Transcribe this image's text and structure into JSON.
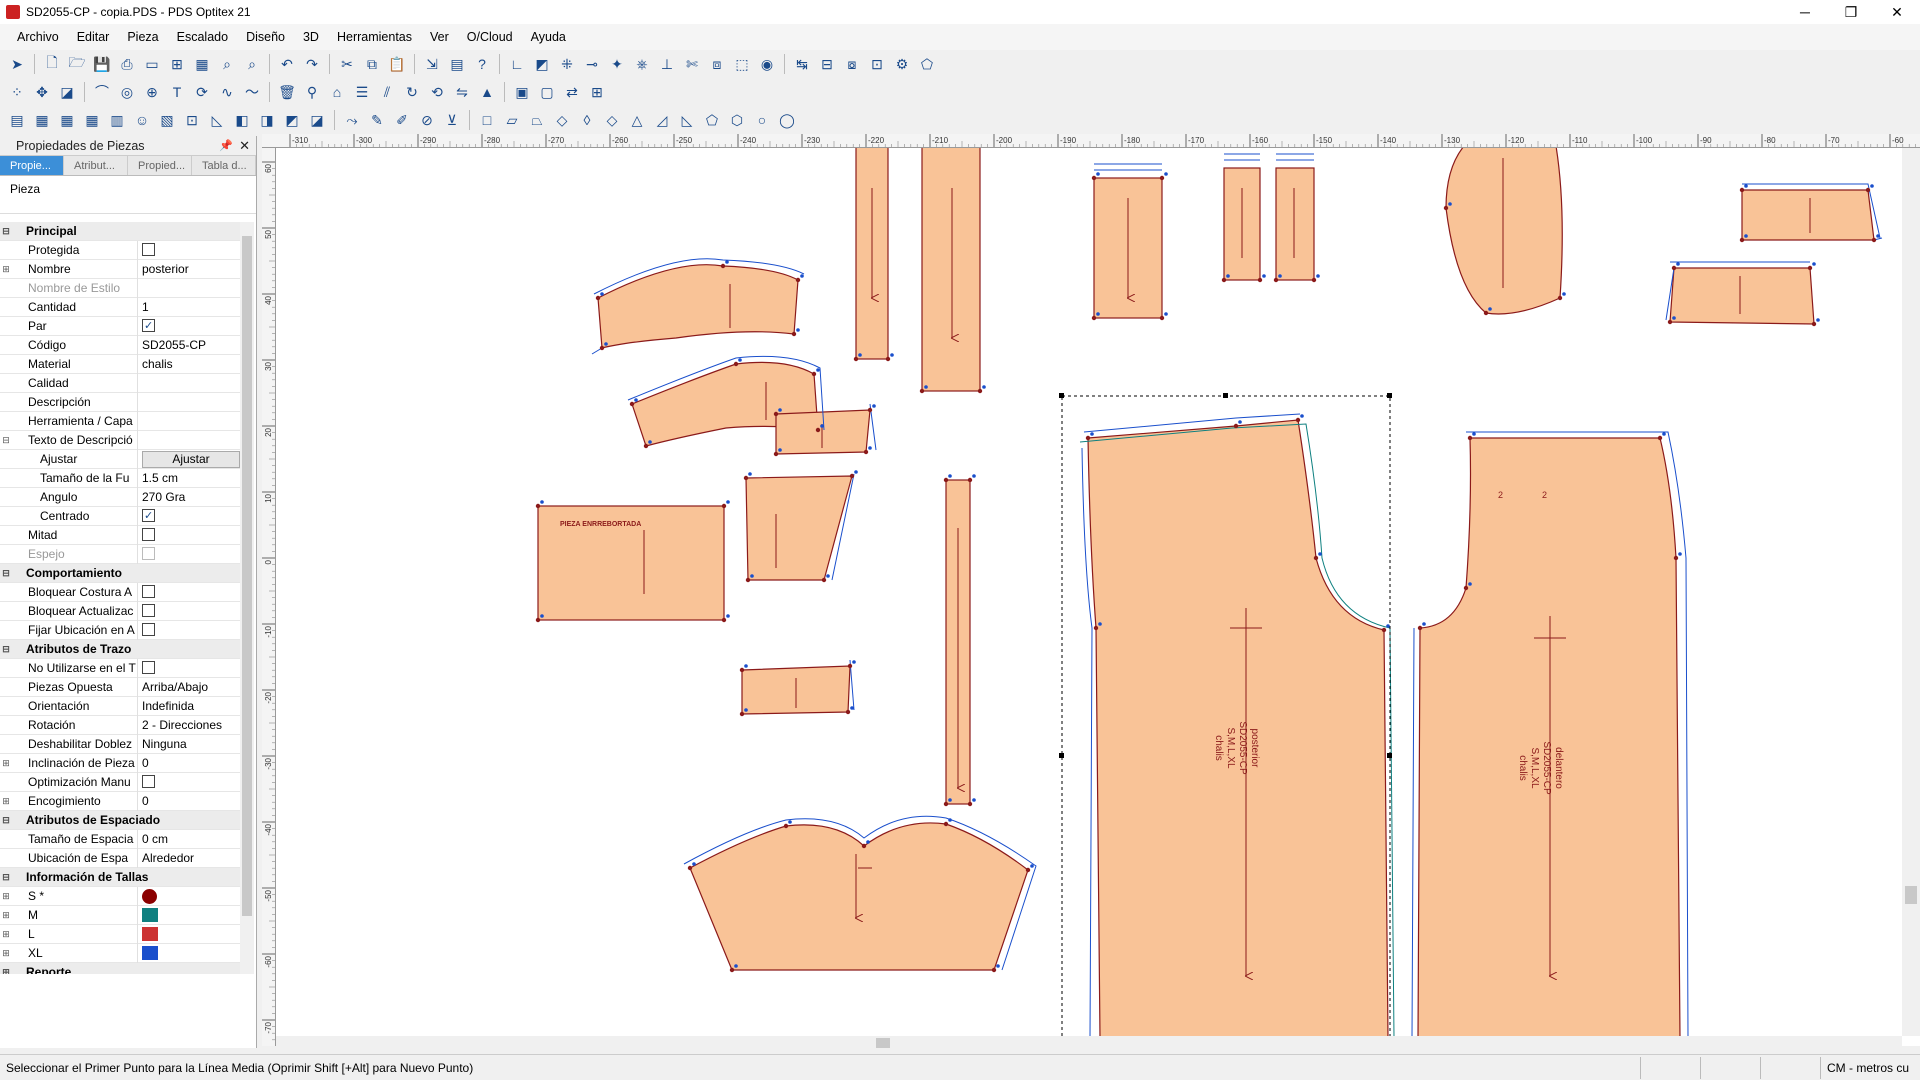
{
  "window": {
    "title": "SD2055-CP - copia.PDS - PDS Optitex 21"
  },
  "menu": [
    "Archivo",
    "Editar",
    "Pieza",
    "Escalado",
    "Diseño",
    "3D",
    "Herramientas",
    "Ver",
    "O/Cloud",
    "Ayuda"
  ],
  "panel": {
    "title": "Propiedades de Piezas",
    "tabs": [
      "Propie...",
      "Atribut...",
      "Propied...",
      "Tabla d..."
    ],
    "object_type": "Pieza"
  },
  "properties": {
    "principal": "Principal",
    "protegida": "Protegida",
    "nombre": "Nombre",
    "nombre_val": "posterior",
    "nombre_estilo": "Nombre de Estilo",
    "cantidad": "Cantidad",
    "cantidad_val": "1",
    "par": "Par",
    "codigo": "Código",
    "codigo_val": "SD2055-CP",
    "material": "Material",
    "material_val": "chalis",
    "calidad": "Calidad",
    "descripcion": "Descripción",
    "herramienta": "Herramienta / Capa",
    "texto_desc": "Texto de Descripció",
    "ajustar": "Ajustar",
    "ajustar_btn": "Ajustar",
    "tamano_fuente": "Tamaño de la Fu",
    "tamano_fuente_val": "1.5 cm",
    "angulo": "Angulo",
    "angulo_val": "270 Gra",
    "centrado": "Centrado",
    "mitad": "Mitad",
    "espejo": "Espejo",
    "comportamiento": "Comportamiento",
    "bloquear_costura": "Bloquear Costura A",
    "bloquear_actualiz": "Bloquear Actualizac",
    "fijar_ubicacion": "Fijar Ubicación en A",
    "atributos_trazo": "Atributos de Trazo",
    "no_utilizarse": "No Utilizarse en el T",
    "piezas_opuesta": "Piezas Opuesta",
    "piezas_opuesta_val": "Arriba/Abajo",
    "orientacion": "Orientación",
    "orientacion_val": "Indefinida",
    "rotacion": "Rotación",
    "rotacion_val": "2 - Direcciones",
    "deshabilitar": "Deshabilitar Doblez",
    "deshabilitar_val": "Ninguna",
    "inclinacion": "Inclinación de Pieza",
    "inclinacion_val": "0",
    "optimizacion": "Optimización Manu",
    "encogimiento": "Encogimiento",
    "encogimiento_val": "0",
    "atributos_espaciado": "Atributos de Espaciado",
    "tamano_espaciado": "Tamaño de Espacia",
    "tamano_espaciado_val": "0 cm",
    "ubicacion_espaciado": "Ubicación de Espa",
    "ubicacion_espaciado_val": "Alrededor",
    "info_tallas": "Información de Tallas",
    "talla_s": "S *",
    "talla_m": "M",
    "talla_l": "L",
    "talla_xl": "XL",
    "reporte": "Reporte"
  },
  "size_colors": {
    "S": "#8b0000",
    "M": "#0f8080",
    "L": "#cc3333",
    "XL": "#1a4fcc"
  },
  "ruler": {
    "top_labels": [
      "-310",
      "-300",
      "-290",
      "-280",
      "-270",
      "-260",
      "-250",
      "-240",
      "-230",
      "-220",
      "-210",
      "-200",
      "-190",
      "-180",
      "-170",
      "-160",
      "-150",
      "-140",
      "-130",
      "-120",
      "-110",
      "-100",
      "-90",
      "-80",
      "-70",
      "-60"
    ],
    "left_labels": [
      "60",
      "50",
      "40",
      "30",
      "20",
      "10",
      "0",
      "-10",
      "-20",
      "-30",
      "-40",
      "-50",
      "-60",
      "-70"
    ]
  },
  "pieces": {
    "label_pieza_enrre": "PIEZA ENRREBORTADA",
    "posterior_lines": [
      "posterior",
      "SD2055-CP",
      "S,M,L,XL",
      "chalis"
    ],
    "delantero_lines": [
      "delantero",
      "SD2055-CP",
      "S,M,L,XL",
      "chalis"
    ],
    "notch_label": "2"
  },
  "piece_fill": "#f9c397",
  "status": {
    "message": "Seleccionar el Primer Punto para la Línea Media (Oprimir Shift [+Alt] para Nuevo Punto)",
    "units": "CM - metros cu"
  }
}
